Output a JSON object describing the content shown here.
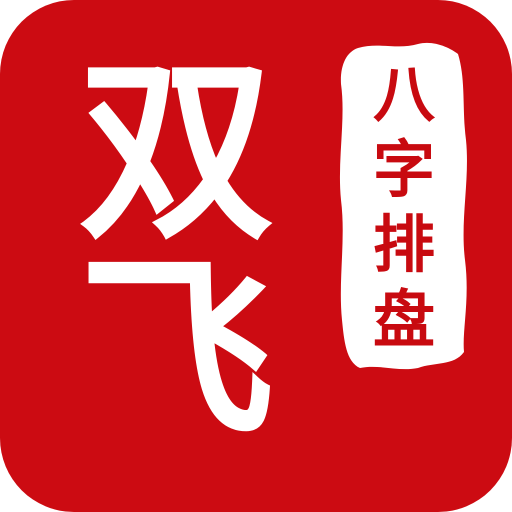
{
  "app_icon": {
    "main_chars": [
      "双",
      "飞"
    ],
    "seal_chars": [
      "八",
      "字",
      "排",
      "盘"
    ],
    "colors": {
      "background": "#cc0b12",
      "main_text": "#ffffff",
      "seal_bg": "#ffffff",
      "seal_text": "#c80a10"
    }
  }
}
